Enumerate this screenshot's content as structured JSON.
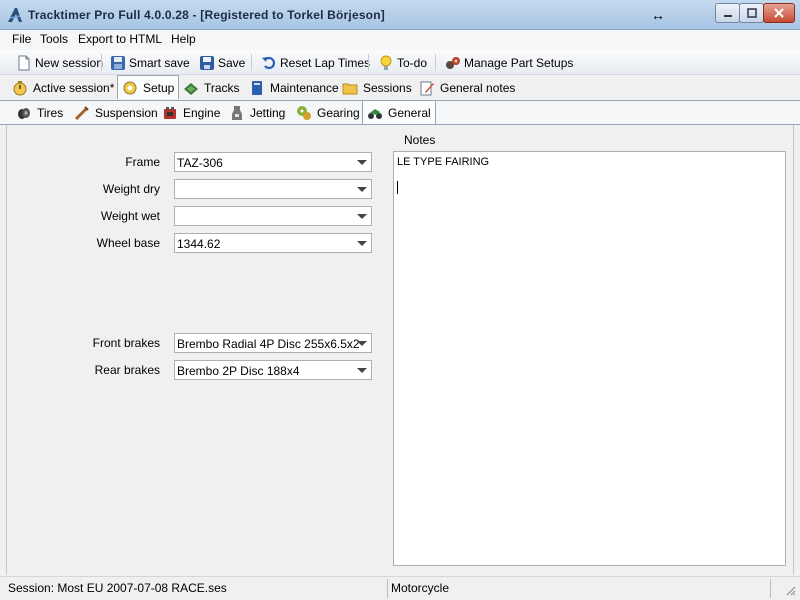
{
  "window": {
    "title": "Tracktimer Pro Full 4.0.0.28  - [Registered to Torkel Börjeson]",
    "resize_cursor": "↔"
  },
  "menu": {
    "items": [
      "File",
      "Tools",
      "Export to HTML",
      "Help"
    ]
  },
  "toolbar": {
    "new_session": "New session",
    "smart_save": "Smart save",
    "save": "Save",
    "reset_lap_times": "Reset Lap Times",
    "todo": "To-do",
    "manage_part_setups": "Manage Part Setups"
  },
  "main_tabs": {
    "active_session": "Active session*",
    "setup": "Setup",
    "tracks": "Tracks",
    "maintenance": "Maintenance",
    "sessions": "Sessions",
    "general_notes": "General notes"
  },
  "setup_tabs": {
    "tires": "Tires",
    "suspension": "Suspension",
    "engine": "Engine",
    "jetting": "Jetting",
    "gearing": "Gearing",
    "general": "General"
  },
  "form": {
    "frame": {
      "label": "Frame",
      "value": "TAZ-306"
    },
    "weight_dry": {
      "label": "Weight dry",
      "value": ""
    },
    "weight_wet": {
      "label": "Weight wet",
      "value": ""
    },
    "wheel_base": {
      "label": "Wheel base",
      "value": "1344.62"
    },
    "front_brakes": {
      "label": "Front brakes",
      "value": "Brembo Radial 4P Disc 255x6.5x2"
    },
    "rear_brakes": {
      "label": "Rear brakes",
      "value": "Brembo 2P Disc 188x4"
    }
  },
  "notes": {
    "label": "Notes",
    "text": "LE TYPE FAIRING"
  },
  "status": {
    "session": "Session: Most EU 2007-07-08 RACE.ses",
    "vehicle": "Motorcycle"
  },
  "colors": {
    "titlebar": "#b4cde8",
    "close_button": "#c64a35",
    "active_tab": "#fbfcfd"
  }
}
